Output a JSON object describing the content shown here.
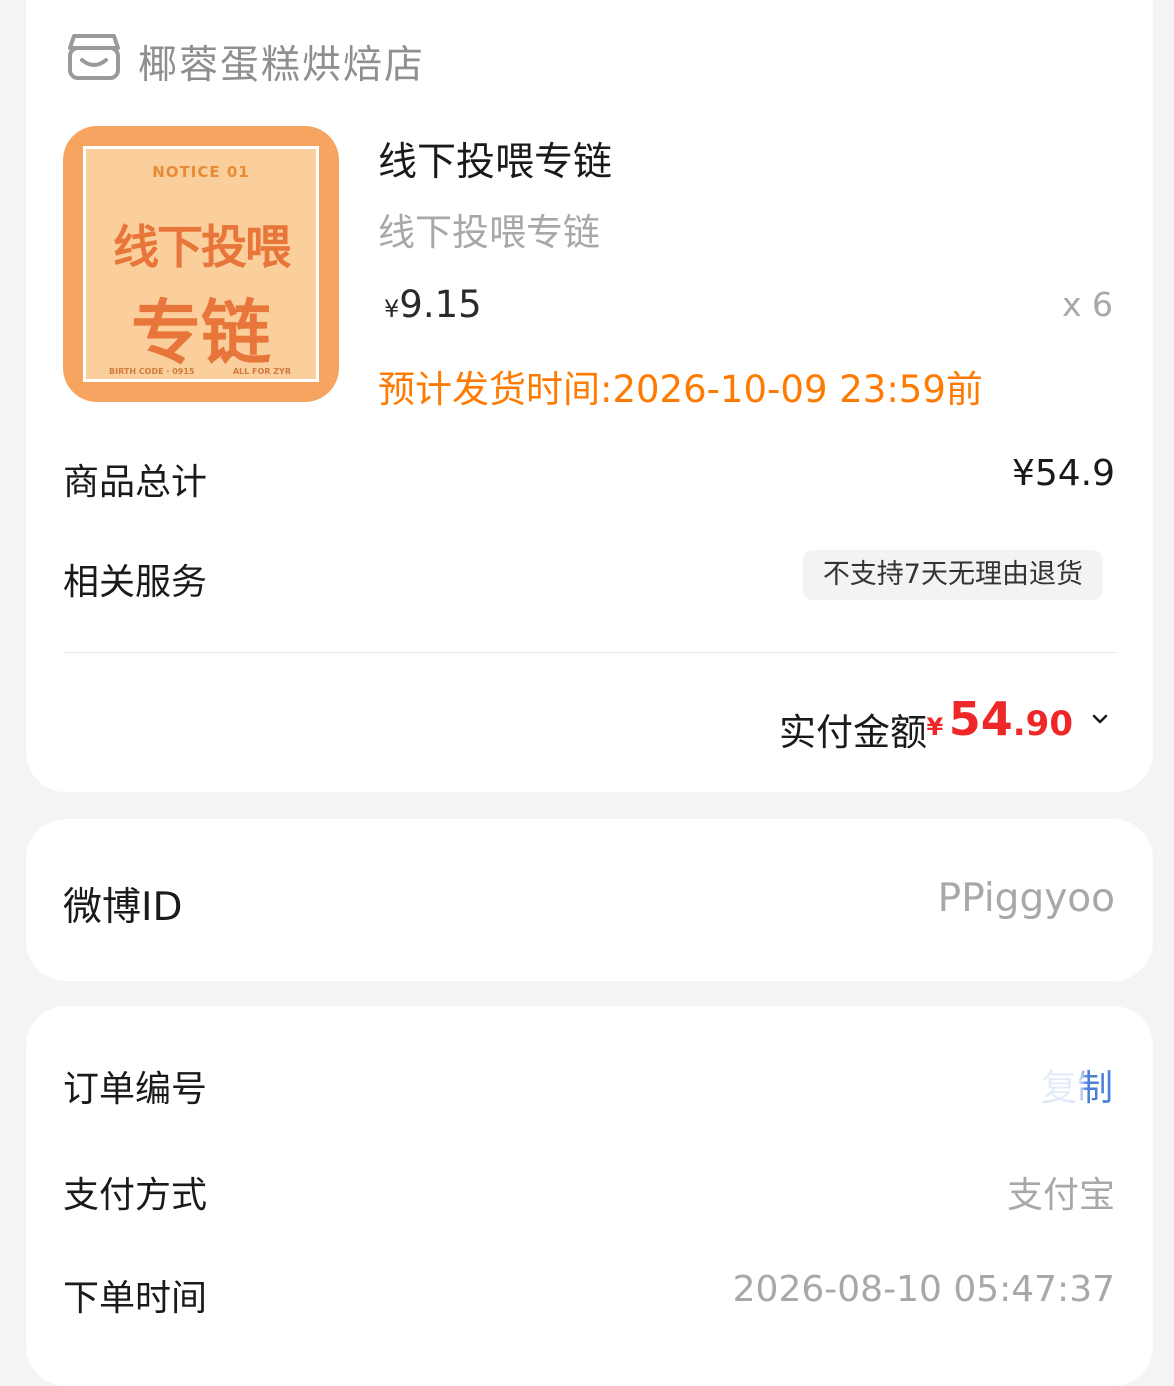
{
  "store": {
    "name": "椰蓉蛋糕烘焙店",
    "icon": "shop-icon"
  },
  "product": {
    "image": {
      "notice": "NOTICE 01",
      "line1": "线下投喂",
      "line2": "专链",
      "footer_left": "BIRTH CODE · 0915",
      "footer_right": "ALL FOR ZYR"
    },
    "title": "线下投喂专链",
    "subtitle": "线下投喂专链",
    "price_symbol": "¥",
    "price": "9.15",
    "quantity": "x 6",
    "ship_estimate": "预计发货时间:2026-10-09 23:59前"
  },
  "summary": {
    "goods_total_label": "商品总计",
    "goods_total_value": "¥54.9",
    "services_label": "相关服务",
    "services_tag": "不支持7天无理由退货",
    "paid_label": "实付金额",
    "paid_symbol": "¥",
    "paid_integer": "54",
    "paid_decimal": ".90"
  },
  "weibo": {
    "label": "微博ID",
    "value": "PPiggyoo"
  },
  "order": {
    "number_label": "订单编号",
    "copy_label": "复制",
    "pay_method_label": "支付方式",
    "pay_method_value": "支付宝",
    "order_time_label": "下单时间",
    "order_time_value": "2026-08-10 05:47:37"
  },
  "colors": {
    "accent_orange": "#ff7a00",
    "price_red": "#ee2828",
    "link_blue": "#4a7fd6"
  }
}
